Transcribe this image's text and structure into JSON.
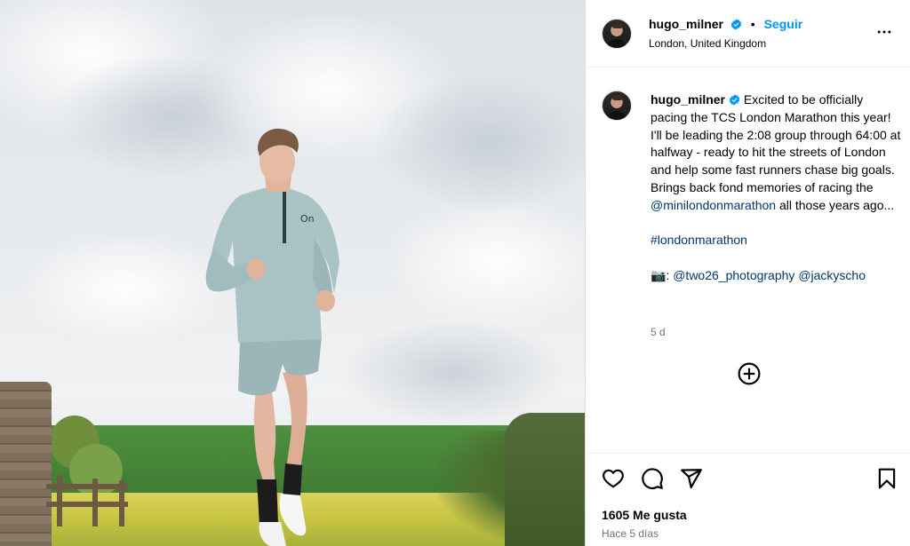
{
  "post": {
    "username": "hugo_milner",
    "follow_label": "Seguir",
    "separator": "•",
    "location": "London, United Kingdom",
    "caption": {
      "line1_text": "Excited to be officially pacing the TCS London Marathon this year! I'll be leading the 2:08 group through 64:00 at halfway - ready to hit the streets of London and help some fast runners chase big goals. Brings back fond memories of racing the ",
      "mention1": "@minilondonmarathon",
      "line1_end": " all those years ago...",
      "hashtag": "#londonmarathon",
      "camera_emoji": "📷",
      "colon": ":",
      "credit1": "@two26_photography",
      "credit2": "@jackyscho"
    },
    "time_short": "5 d",
    "likes": "1605 Me gusta",
    "posted_ago": "Hace 5 días"
  },
  "icons": {
    "more": "more-options-icon",
    "verified": "verified-badge-icon",
    "add_comment": "add-circle-icon",
    "like": "heart-icon",
    "comment": "comment-icon",
    "share": "share-icon",
    "save": "bookmark-icon"
  },
  "colors": {
    "link": "#0095f6",
    "mention": "#00376b",
    "muted": "#737373",
    "verified": "#0095f6"
  }
}
